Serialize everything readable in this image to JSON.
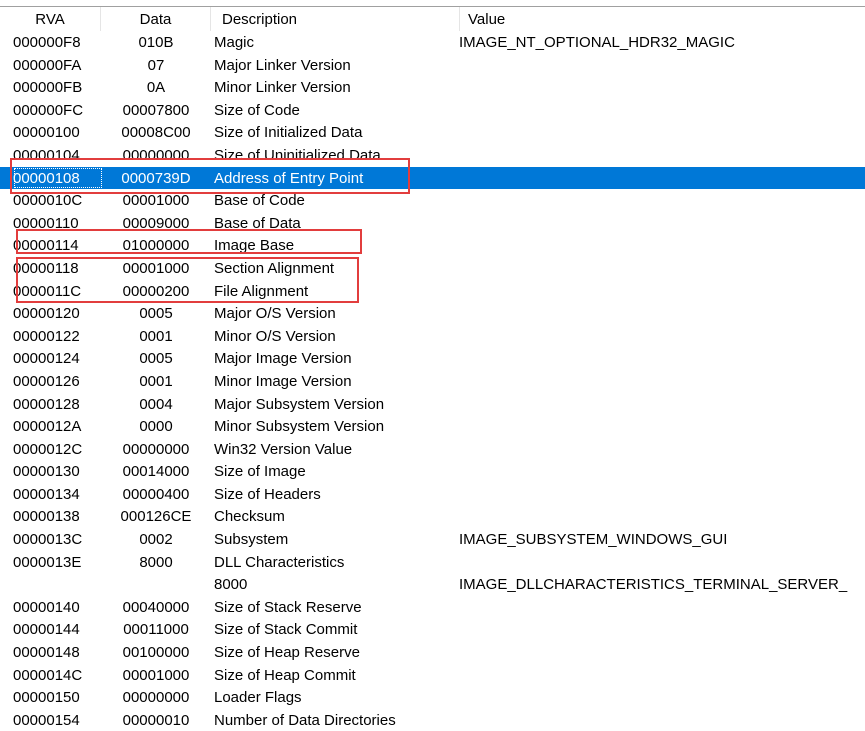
{
  "columns": {
    "rva": "RVA",
    "data": "Data",
    "description": "Description",
    "value": "Value"
  },
  "rows": [
    {
      "rva": "000000F8",
      "data": "010B",
      "description": "Magic",
      "value": "IMAGE_NT_OPTIONAL_HDR32_MAGIC"
    },
    {
      "rva": "000000FA",
      "data": "07",
      "description": "Major Linker Version",
      "value": ""
    },
    {
      "rva": "000000FB",
      "data": "0A",
      "description": "Minor Linker Version",
      "value": ""
    },
    {
      "rva": "000000FC",
      "data": "00007800",
      "description": "Size of Code",
      "value": ""
    },
    {
      "rva": "00000100",
      "data": "00008C00",
      "description": "Size of Initialized Data",
      "value": ""
    },
    {
      "rva": "00000104",
      "data": "00000000",
      "description": "Size of Uninitialized Data",
      "value": ""
    },
    {
      "rva": "00000108",
      "data": "0000739D",
      "description": "Address of Entry Point",
      "value": ""
    },
    {
      "rva": "0000010C",
      "data": "00001000",
      "description": "Base of Code",
      "value": ""
    },
    {
      "rva": "00000110",
      "data": "00009000",
      "description": "Base of Data",
      "value": ""
    },
    {
      "rva": "00000114",
      "data": "01000000",
      "description": "Image Base",
      "value": ""
    },
    {
      "rva": "00000118",
      "data": "00001000",
      "description": "Section Alignment",
      "value": ""
    },
    {
      "rva": "0000011C",
      "data": "00000200",
      "description": "File Alignment",
      "value": ""
    },
    {
      "rva": "00000120",
      "data": "0005",
      "description": "Major O/S Version",
      "value": ""
    },
    {
      "rva": "00000122",
      "data": "0001",
      "description": "Minor O/S Version",
      "value": ""
    },
    {
      "rva": "00000124",
      "data": "0005",
      "description": "Major Image Version",
      "value": ""
    },
    {
      "rva": "00000126",
      "data": "0001",
      "description": "Minor Image Version",
      "value": ""
    },
    {
      "rva": "00000128",
      "data": "0004",
      "description": "Major Subsystem Version",
      "value": ""
    },
    {
      "rva": "0000012A",
      "data": "0000",
      "description": "Minor Subsystem Version",
      "value": ""
    },
    {
      "rva": "0000012C",
      "data": "00000000",
      "description": "Win32 Version Value",
      "value": ""
    },
    {
      "rva": "00000130",
      "data": "00014000",
      "description": "Size of Image",
      "value": ""
    },
    {
      "rva": "00000134",
      "data": "00000400",
      "description": "Size of Headers",
      "value": ""
    },
    {
      "rva": "00000138",
      "data": "000126CE",
      "description": "Checksum",
      "value": ""
    },
    {
      "rva": "0000013C",
      "data": "0002",
      "description": "Subsystem",
      "value": "IMAGE_SUBSYSTEM_WINDOWS_GUI"
    },
    {
      "rva": "0000013E",
      "data": "8000",
      "description": "DLL Characteristics",
      "value": ""
    },
    {
      "rva": "",
      "data": "",
      "description": "8000",
      "value": "IMAGE_DLLCHARACTERISTICS_TERMINAL_SERVER_"
    },
    {
      "rva": "00000140",
      "data": "00040000",
      "description": "Size of Stack Reserve",
      "value": ""
    },
    {
      "rva": "00000144",
      "data": "00011000",
      "description": "Size of Stack Commit",
      "value": ""
    },
    {
      "rva": "00000148",
      "data": "00100000",
      "description": "Size of Heap Reserve",
      "value": ""
    },
    {
      "rva": "0000014C",
      "data": "00001000",
      "description": "Size of Heap Commit",
      "value": ""
    },
    {
      "rva": "00000150",
      "data": "00000000",
      "description": "Loader Flags",
      "value": ""
    },
    {
      "rva": "00000154",
      "data": "00000010",
      "description": "Number of Data Directories",
      "value": ""
    }
  ],
  "selected_row_rva": "00000108",
  "colors": {
    "selection": "#0078d7",
    "highlight_box": "#e23d3d"
  }
}
